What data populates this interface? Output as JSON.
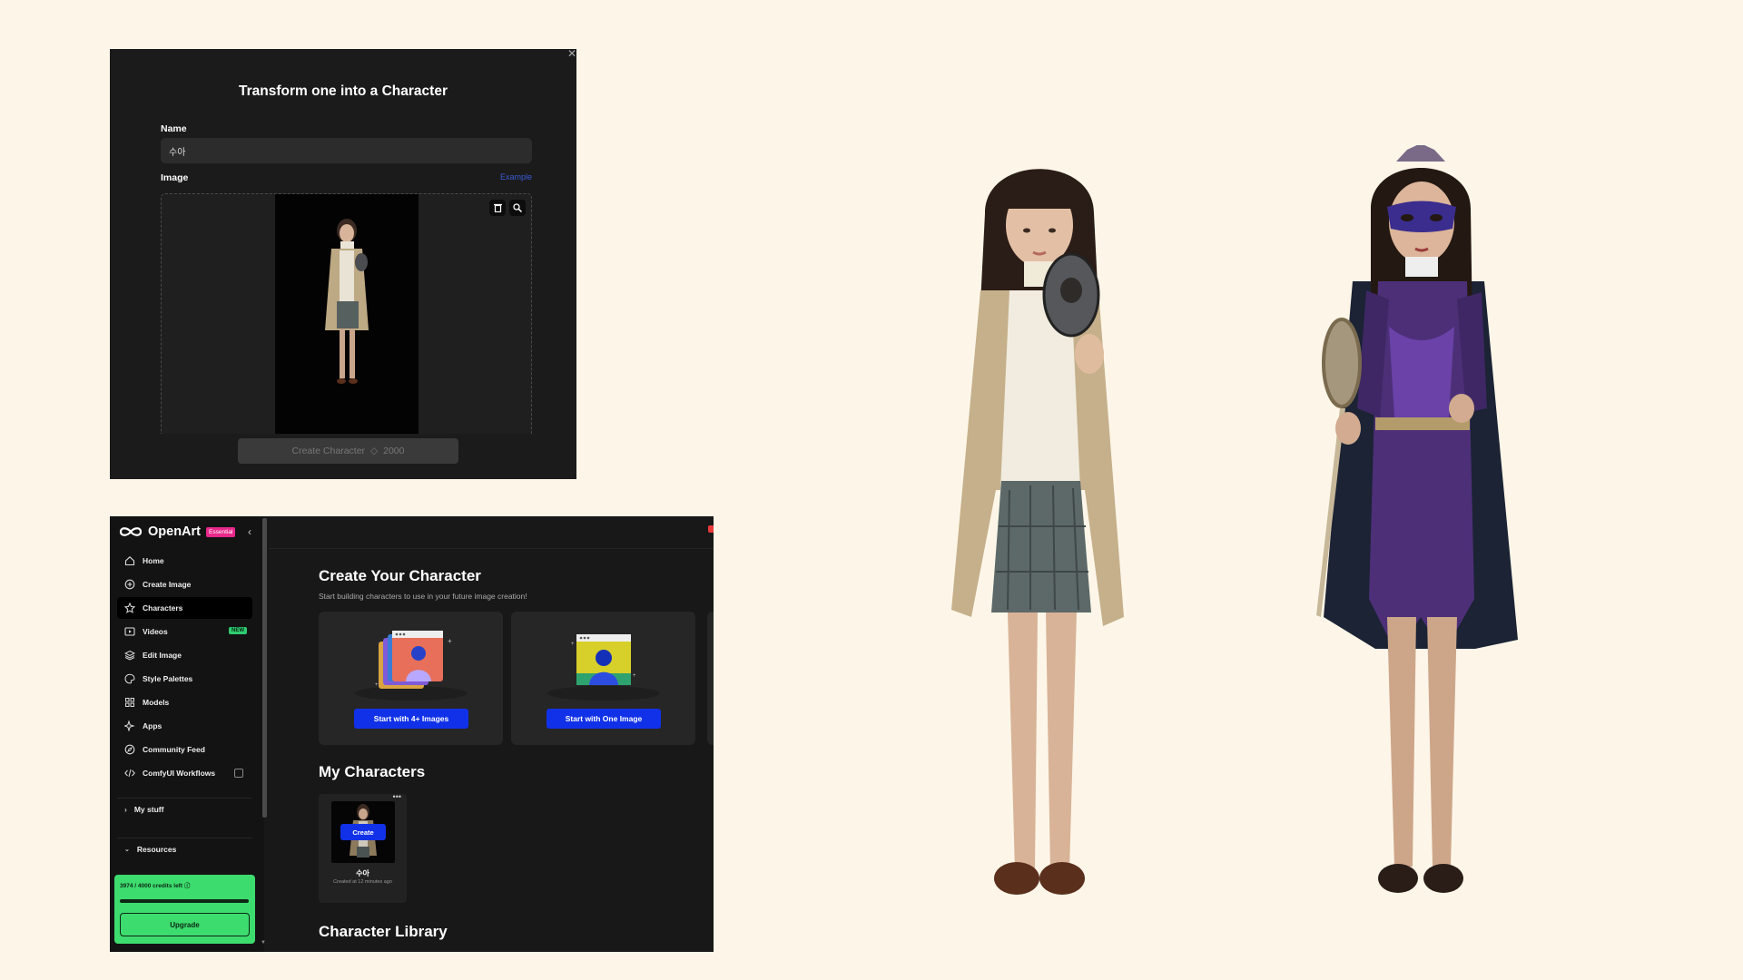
{
  "dialog": {
    "title": "Transform one into a Character",
    "name_label": "Name",
    "name_value": "수아",
    "image_label": "Image",
    "example_link": "Example",
    "create_button": "Create Character",
    "cost": "2000"
  },
  "app": {
    "logo": "OpenArt",
    "plan_badge": "Essential",
    "nav": [
      {
        "label": "Home",
        "icon": "home-icon"
      },
      {
        "label": "Create Image",
        "icon": "plus-circle-icon"
      },
      {
        "label": "Characters",
        "icon": "star-icon",
        "active": true
      },
      {
        "label": "Videos",
        "icon": "video-icon",
        "badge": "NEW"
      },
      {
        "label": "Edit Image",
        "icon": "layers-icon"
      },
      {
        "label": "Style Palettes",
        "icon": "palette-icon"
      },
      {
        "label": "Models",
        "icon": "grid-icon"
      },
      {
        "label": "Apps",
        "icon": "sparkle-icon"
      },
      {
        "label": "Community Feed",
        "icon": "compass-icon"
      },
      {
        "label": "ComfyUI Workflows",
        "icon": "code-icon"
      }
    ],
    "my_stuff": "My stuff",
    "resources": "Resources",
    "credits_text": "3974 / 4000 credits left",
    "credits_fraction": 0.9935,
    "upgrade": "Upgrade",
    "main": {
      "title": "Create Your Character",
      "subtitle": "Start building characters to use in your future image creation!",
      "card1_button": "Start with 4+ Images",
      "card2_button": "Start with One Image",
      "my_characters_title": "My Characters",
      "character": {
        "create_button": "Create",
        "name": "수아",
        "meta": "Created at 12 minutes ago"
      },
      "library_title": "Character Library"
    }
  },
  "colors": {
    "page_bg": "#fdf6e8",
    "accent_blue": "#1131e8",
    "credits_green": "#3ddc6e",
    "badge_pink": "#e8288b"
  }
}
